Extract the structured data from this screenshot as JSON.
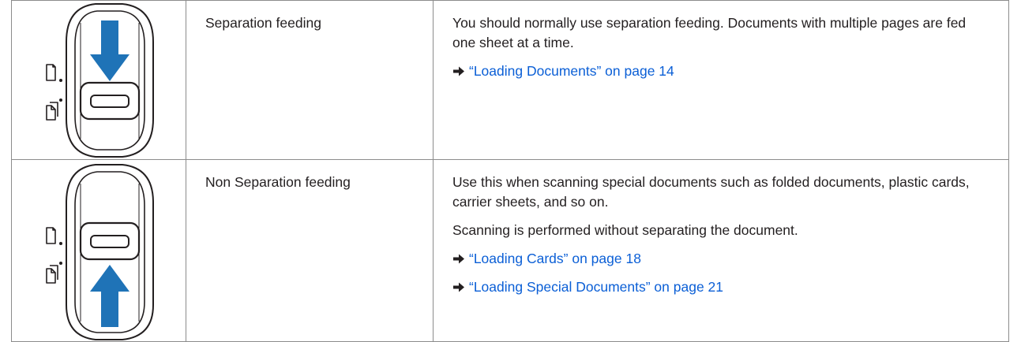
{
  "rows": [
    {
      "name": "Separation feeding",
      "description": [
        "You should normally use separation feeding. Documents with multiple pages are fed one sheet at a time."
      ],
      "links": [
        "“Loading Documents” on page 14"
      ]
    },
    {
      "name": "Non Separation feeding",
      "description": [
        "Use this when scanning special documents such as folded documents, plastic cards, carrier sheets, and so on.",
        "Scanning is performed without separating the document."
      ],
      "links": [
        "“Loading Cards” on page 18",
        "“Loading Special Documents” on page 21"
      ]
    }
  ],
  "colors": {
    "arrow": "#1f73b7",
    "link": "#0b5fd6",
    "border": "#8c8c8c",
    "text": "#231f20"
  },
  "icons": [
    "single-sheet-icon",
    "stacked-sheets-icon",
    "arrow-down-icon",
    "arrow-up-icon",
    "link-arrow-icon"
  ]
}
